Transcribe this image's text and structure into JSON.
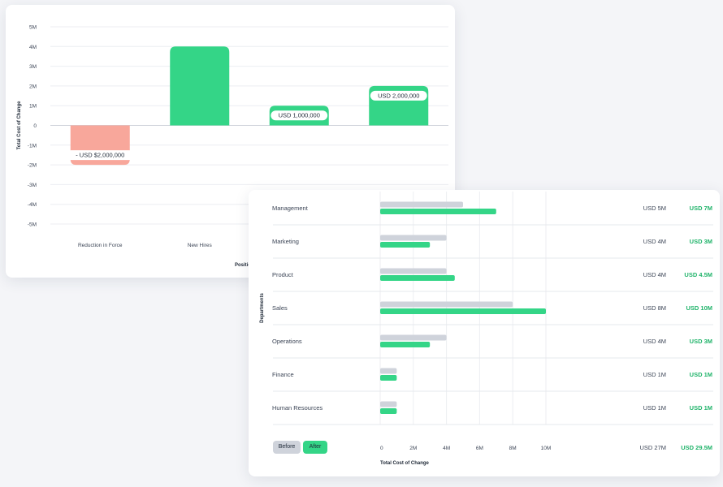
{
  "colors": {
    "negative": "#f8a79b",
    "positive": "#34d587",
    "before": "#cfd3db",
    "after": "#34d587",
    "grid": "#eceef2",
    "after_text": "#22b46b"
  },
  "chart_data": [
    {
      "type": "bar",
      "ylabel": "Total Cost of Change",
      "xlabel": "Positio",
      "categories": [
        "Reduction in Force",
        "New Hires",
        "",
        ""
      ],
      "values": [
        -2,
        4,
        1,
        2
      ],
      "unit": "M",
      "ylim": [
        -5,
        5
      ],
      "yticks": [
        "5M",
        "4M",
        "3M",
        "2M",
        "1M",
        "0",
        "-1M",
        "-2M",
        "-3M",
        "-4M",
        "-5M"
      ],
      "data_labels": [
        "- USD $2,000,000",
        "",
        "USD 1,000,000",
        "USD 2,000,000"
      ],
      "grid": true
    },
    {
      "type": "bar",
      "orientation": "horizontal",
      "ylabel": "Departments",
      "xlabel": "Total Cost of Change",
      "categories": [
        "Management",
        "Marketing",
        "Product",
        "Sales",
        "Operations",
        "Finance",
        "Human Resources"
      ],
      "series": [
        {
          "name": "Before",
          "values": [
            5,
            4,
            4,
            8,
            4,
            1,
            1
          ]
        },
        {
          "name": "After",
          "values": [
            7,
            3,
            4.5,
            10,
            3,
            1,
            1
          ]
        }
      ],
      "before_labels": [
        "USD 5M",
        "USD 4M",
        "USD 4M",
        "USD 8M",
        "USD 4M",
        "USD 1M",
        "USD 1M"
      ],
      "after_labels": [
        "USD 7M",
        "USD 3M",
        "USD 4.5M",
        "USD 10M",
        "USD 3M",
        "USD 1M",
        "USD 1M"
      ],
      "totals": {
        "before": "USD 27M",
        "after": "USD 29.5M"
      },
      "xticks": [
        "0",
        "2M",
        "4M",
        "6M",
        "8M",
        "10M"
      ],
      "xlim": [
        0,
        10
      ],
      "grid": true
    }
  ],
  "legend": {
    "before_label": "Before",
    "after_label": "After"
  }
}
